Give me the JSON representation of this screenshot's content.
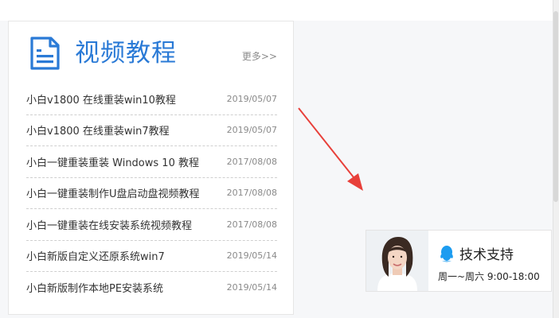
{
  "panel": {
    "title": "视频教程",
    "more_label": "更多>>",
    "items": [
      {
        "title": "小白v1800 在线重装win10教程",
        "date": "2019/05/07"
      },
      {
        "title": "小白v1800 在线重装win7教程",
        "date": "2019/05/07"
      },
      {
        "title": "小白一键重装重装 Windows 10 教程",
        "date": "2017/08/08"
      },
      {
        "title": "小白一键重装制作U盘启动盘视频教程",
        "date": "2017/08/08"
      },
      {
        "title": "小白一键重装在线安装系统视频教程",
        "date": "2017/08/08"
      },
      {
        "title": "小白新版自定义还原系统win7",
        "date": "2019/05/14"
      },
      {
        "title": "小白新版制作本地PE安装系统",
        "date": "2019/05/14"
      }
    ]
  },
  "support": {
    "title": "技术支持",
    "hours": "周一~周六 9:00-18:00"
  },
  "colors": {
    "accent": "#2a7ad6",
    "arrow": "#e8403a",
    "qq": "#1c9cf0"
  },
  "icons": {
    "panel_icon": "document-icon",
    "support_icon": "qq-penguin-icon",
    "annotation": "red-arrow-icon"
  }
}
